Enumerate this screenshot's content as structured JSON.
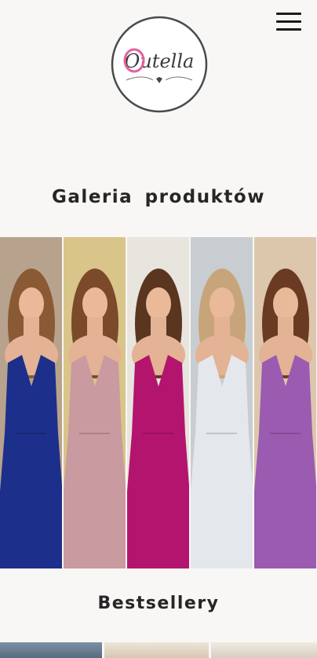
{
  "header": {
    "logo_text": "Outella",
    "menu_icon": "hamburger-menu-icon"
  },
  "gallery": {
    "title": "Galeria  produktów",
    "items": [
      {
        "name": "navy-dress",
        "dress_color": "#1c2f8a",
        "bg_color": "#b7a28d"
      },
      {
        "name": "powder-pink-dress",
        "dress_color": "#c99aa0",
        "bg_color": "#d9c48a"
      },
      {
        "name": "fuchsia-dress",
        "dress_color": "#b3156e",
        "bg_color": "#e8e4de"
      },
      {
        "name": "white-dress",
        "dress_color": "#e4e8ec",
        "bg_color": "#c8cdd1"
      },
      {
        "name": "lilac-dress",
        "dress_color": "#9a5bb0",
        "bg_color": "#dcc7ad"
      }
    ]
  },
  "bestsellers": {
    "title": "Bestsellery"
  },
  "colors": {
    "background": "#f9f7f5",
    "text": "#262626",
    "logo_accent": "#e2619f"
  }
}
